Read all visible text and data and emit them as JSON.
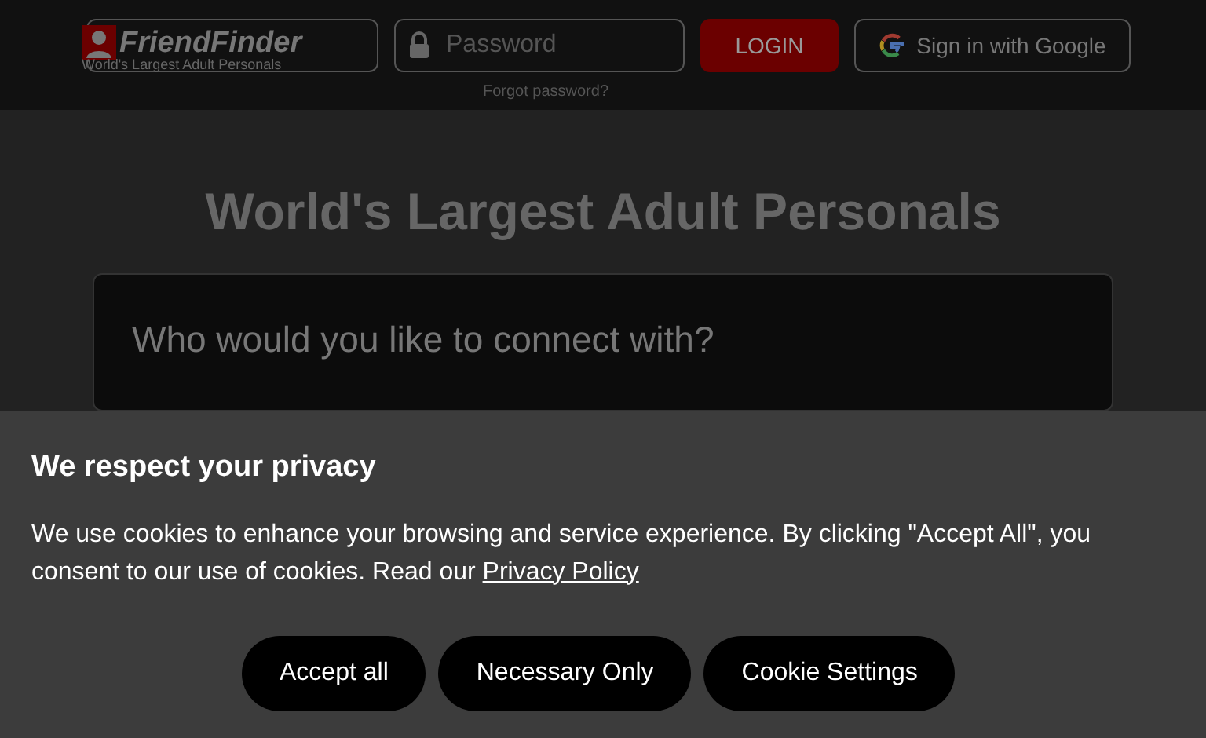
{
  "header": {
    "logo": "FriendFinder",
    "tagline": "World's Largest Adult Personals",
    "password": {
      "placeholder": "Password"
    },
    "login": "LOGIN",
    "google": "Sign in with Google",
    "forgot": "Forgot password?"
  },
  "hero": {
    "title": "World's Largest Adult Personals",
    "question": "Who would you like to connect with?"
  },
  "cookie": {
    "title": "We respect your privacy",
    "text": "We use cookies to enhance your browsing and service experience. By clicking \"Accept All\", you consent to our use of cookies. Read our ",
    "link": "Privacy Policy",
    "buttons": [
      "Accept all",
      "Necessary Only",
      "Cookie Settings"
    ]
  }
}
